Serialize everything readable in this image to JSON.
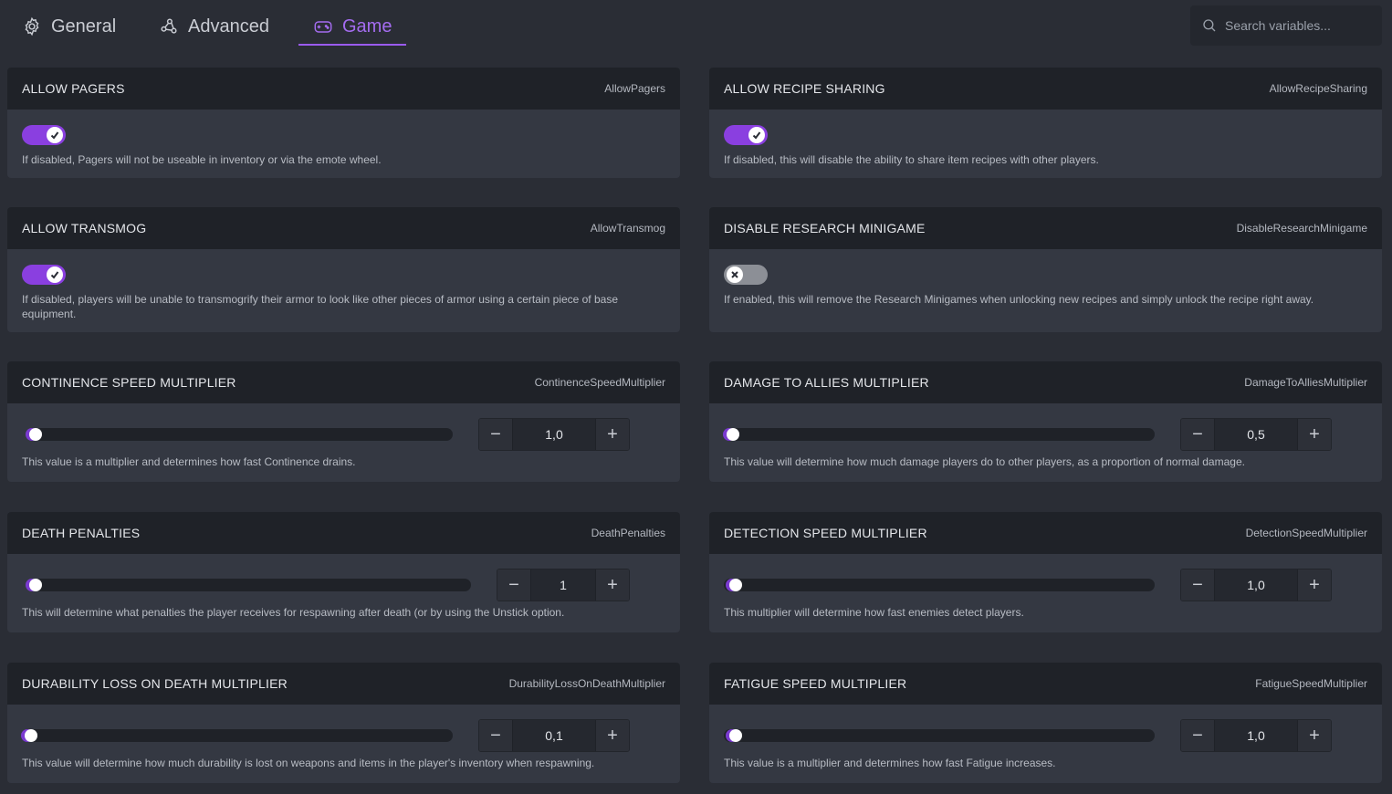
{
  "tabs": [
    {
      "label": "General",
      "icon": "gear-icon"
    },
    {
      "label": "Advanced",
      "icon": "advanced-nodes-icon"
    },
    {
      "label": "Game",
      "icon": "gamepad-icon",
      "active": true
    }
  ],
  "search": {
    "placeholder": "Search variables..."
  },
  "colors": {
    "accent": "#9a5bf0",
    "toggle_on": "#8a3fe0",
    "toggle_off": "#8c8f96"
  },
  "settings": {
    "allow_pagers": {
      "title": "ALLOW PAGERS",
      "var": "AllowPagers",
      "enabled": true,
      "desc": "If disabled, Pagers will not be useable in inventory or via the emote wheel."
    },
    "allow_recipe_sharing": {
      "title": "ALLOW RECIPE SHARING",
      "var": "AllowRecipeSharing",
      "enabled": true,
      "desc": "If disabled, this will disable the ability to share item recipes with other players."
    },
    "allow_transmog": {
      "title": "ALLOW TRANSMOG",
      "var": "AllowTransmog",
      "enabled": true,
      "desc": "If disabled, players will be unable to transmogrify their armor to look like other pieces of armor using a certain piece of base equipment."
    },
    "disable_research_minigame": {
      "title": "DISABLE RESEARCH MINIGAME",
      "var": "DisableResearchMinigame",
      "enabled": false,
      "desc": "If enabled, this will remove the Research Minigames when unlocking new recipes and simply unlock the recipe right away."
    },
    "continence_speed": {
      "title": "CONTINENCE SPEED MULTIPLIER",
      "var": "ContinenceSpeedMultiplier",
      "value": "1,0",
      "desc": "This value is a multiplier and determines how fast Continence drains."
    },
    "damage_to_allies": {
      "title": "DAMAGE TO ALLIES MULTIPLIER",
      "var": "DamageToAlliesMultiplier",
      "value": "0,5",
      "desc": "This value will determine how much damage players do to other players, as a proportion of normal damage."
    },
    "death_penalties": {
      "title": "DEATH PENALTIES",
      "var": "DeathPenalties",
      "value": "1",
      "desc": "This will determine what penalties the player receives for respawning after death (or by using the Unstick option."
    },
    "detection_speed": {
      "title": "DETECTION SPEED MULTIPLIER",
      "var": "DetectionSpeedMultiplier",
      "value": "1,0",
      "desc": "This multiplier will determine how fast enemies detect players."
    },
    "durability_loss": {
      "title": "DURABILITY LOSS ON DEATH MULTIPLIER",
      "var": "DurabilityLossOnDeathMultiplier",
      "value": "0,1",
      "desc": "This value will determine how much durability is lost on weapons and items in the player's inventory when respawning."
    },
    "fatigue_speed": {
      "title": "FATIGUE SPEED MULTIPLIER",
      "var": "FatigueSpeedMultiplier",
      "value": "1,0",
      "desc": "This value is a multiplier and determines how fast Fatigue increases."
    }
  },
  "stepper": {
    "minus": "−",
    "plus": "+"
  }
}
